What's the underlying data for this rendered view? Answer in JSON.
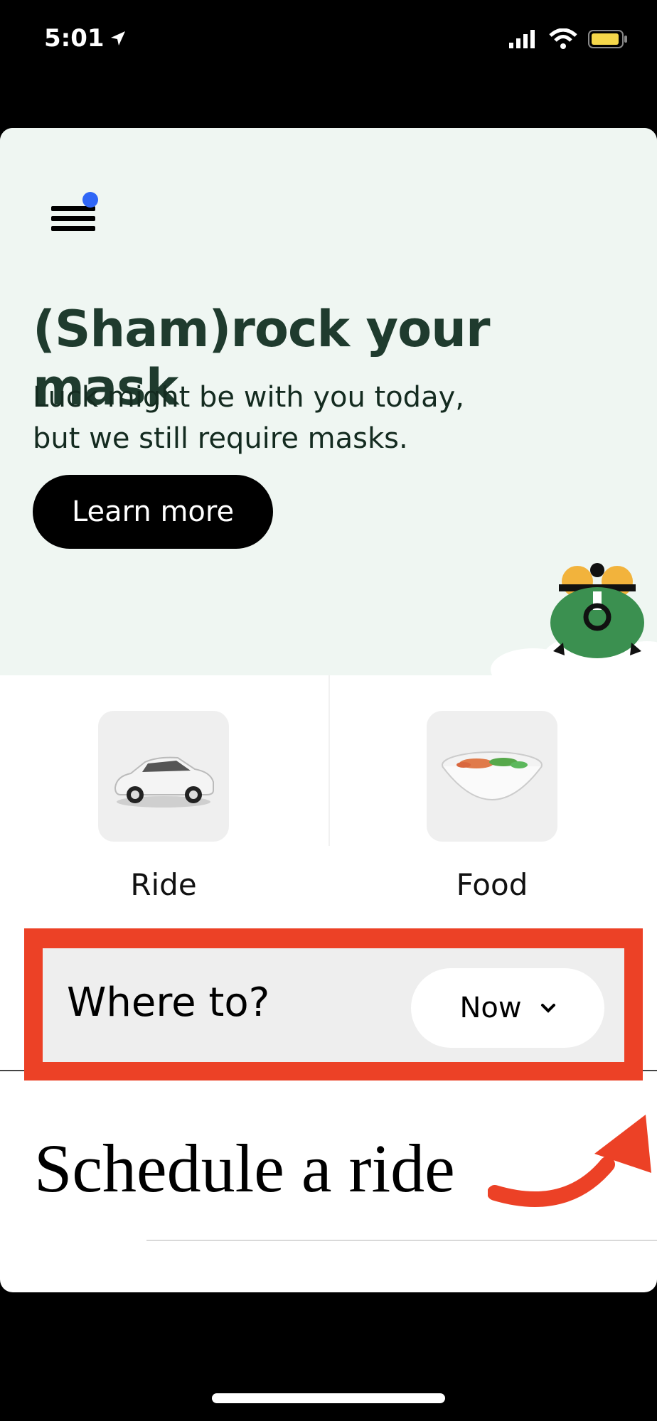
{
  "status_bar": {
    "time": "5:01",
    "location_icon": "location-arrow-icon",
    "signal_icon": "cellular-signal-icon",
    "wifi_icon": "wifi-icon",
    "battery_icon": "battery-icon",
    "battery_color": "#f5d74a"
  },
  "hero": {
    "title": "(Sham)rock your mask",
    "subtitle_line1": "Luck might be with you today,",
    "subtitle_line2": "but we still require masks.",
    "button_label": "Learn more",
    "background": "#eff6f2",
    "menu_icon": "hamburger-menu-icon",
    "notification_dot_color": "#2f66f6",
    "illustration": "pot-of-gold-icon"
  },
  "services": [
    {
      "label": "Ride",
      "icon": "car-icon"
    },
    {
      "label": "Food",
      "icon": "food-bowl-icon"
    }
  ],
  "search": {
    "placeholder": "Where to?",
    "time_pill": "Now",
    "highlight_color": "#ec4126"
  },
  "annotation": {
    "text": "Schedule a ride",
    "arrow_color": "#ec4126"
  }
}
